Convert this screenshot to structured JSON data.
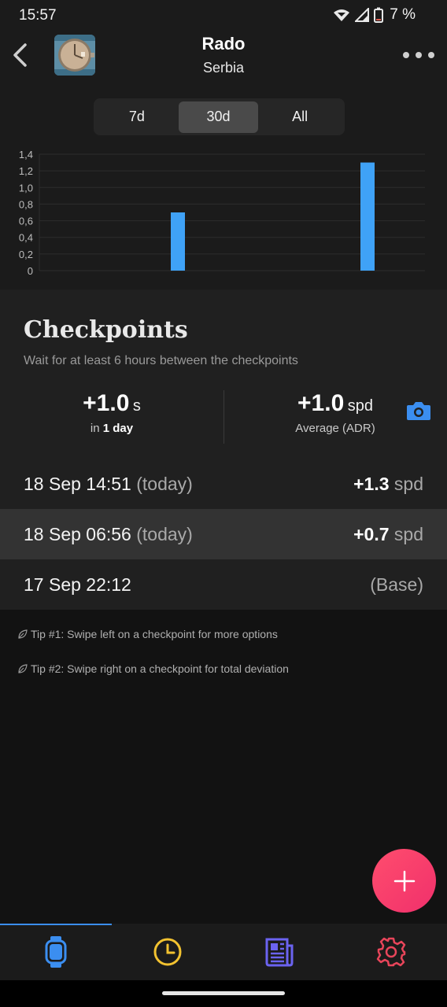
{
  "status_bar": {
    "time": "15:57",
    "battery": "7 %"
  },
  "header": {
    "title": "Rado",
    "subtitle": "Serbia"
  },
  "range_tabs": [
    {
      "label": "7d",
      "active": false
    },
    {
      "label": "30d",
      "active": true
    },
    {
      "label": "All",
      "active": false
    }
  ],
  "chart_data": {
    "type": "bar",
    "y_ticks": [
      "1,4",
      "1,2",
      "1,0",
      "0,8",
      "0,6",
      "0,4",
      "0,2",
      "0"
    ],
    "ylim": [
      0,
      1.4
    ],
    "bars": [
      {
        "label": "18 Sep 06:56",
        "value": 0.7
      },
      {
        "label": "18 Sep 14:51",
        "value": 1.3
      }
    ],
    "bar_color": "#3fa2f7",
    "grid": true
  },
  "checkpoints": {
    "title": "Checkpoints",
    "subtitle": "Wait for at least 6 hours between the checkpoints",
    "summary": {
      "deviation_value": "+1.0",
      "deviation_unit": "s",
      "deviation_caption_prefix": "in",
      "deviation_caption_bold": "1 day",
      "rate_value": "+1.0",
      "rate_unit": "spd",
      "rate_caption": "Average (ADR)"
    },
    "rows": [
      {
        "date": "18 Sep 14:51",
        "relative": "(today)",
        "value": "+1.3",
        "unit": "spd",
        "base": "",
        "highlight": false
      },
      {
        "date": "18 Sep 06:56",
        "relative": "(today)",
        "value": "+0.7",
        "unit": "spd",
        "base": "",
        "highlight": true
      },
      {
        "date": "17 Sep 22:12",
        "relative": "",
        "value": "",
        "unit": "",
        "base": "(Base)",
        "highlight": false
      }
    ]
  },
  "tips": [
    "Tip #1: Swipe left on a checkpoint for more options",
    "Tip #2: Swipe right on a checkpoint for total deviation"
  ],
  "bottom_nav": [
    {
      "icon": "watch-icon",
      "color": "#3b8ef0",
      "active": true
    },
    {
      "icon": "clock-icon",
      "color": "#f2c230",
      "active": false
    },
    {
      "icon": "news-icon",
      "color": "#6b63f0",
      "active": false
    },
    {
      "icon": "settings-icon",
      "color": "#e8455a",
      "active": false
    }
  ],
  "colors": {
    "accent": "#3b8ef0",
    "fab": "#f0306c"
  }
}
